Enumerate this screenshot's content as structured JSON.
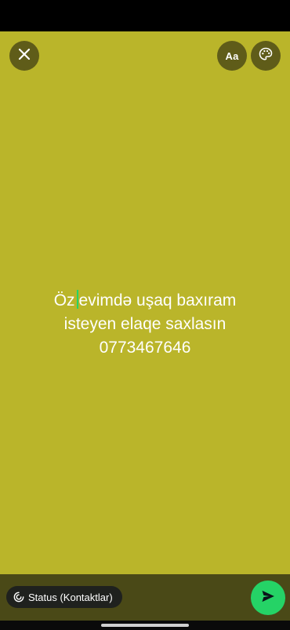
{
  "editor": {
    "background_color": "#bab52a",
    "font_button_label": "Aa",
    "text_before_cursor": "Öz",
    "text_after_cursor": "evimdə uşaq baxıram",
    "line2": "isteyen elaqe saxlasın",
    "line3": "0773467646"
  },
  "toolbar": {
    "close_icon": "close-icon",
    "palette_icon": "palette-icon"
  },
  "footer": {
    "audience_label": "Status (Kontaktlar)",
    "audience_icon": "status-ring-icon",
    "send_icon": "send-icon",
    "accent_color": "#25d366"
  }
}
